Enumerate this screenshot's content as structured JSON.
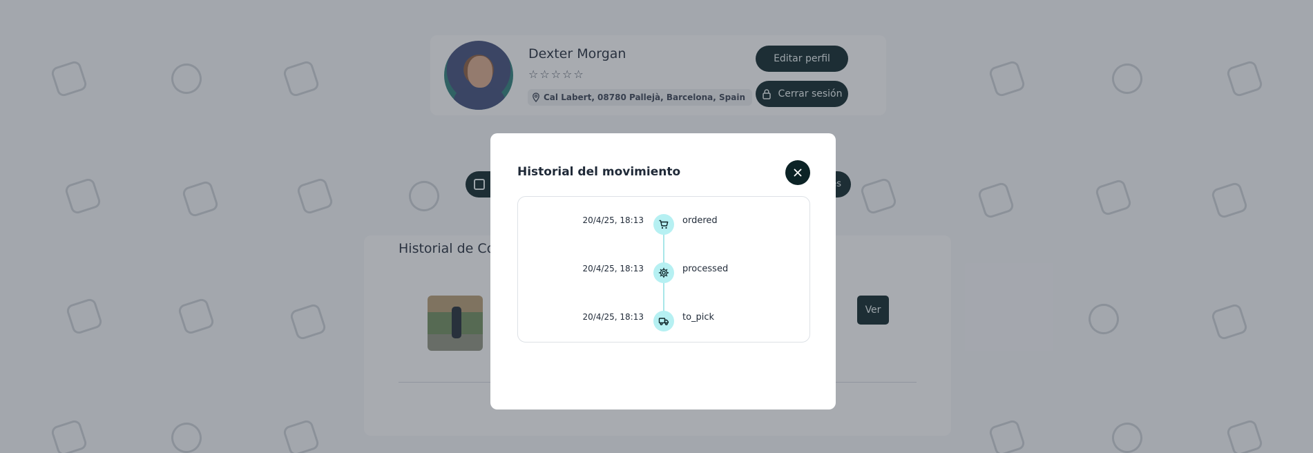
{
  "profile": {
    "name": "Dexter Morgan",
    "rating_stars": [
      "☆",
      "☆",
      "☆",
      "☆",
      "☆"
    ],
    "location": "Cal Labert, 08780 Pallejà, Barcelona, Spain",
    "edit_label": "Editar perfil",
    "logout_label": "Cerrar sesión"
  },
  "nav": {
    "tail_text": "es"
  },
  "purchases": {
    "title_visible": "Historial de Co",
    "view_label": "Ver"
  },
  "modal": {
    "title": "Historial del movimiento",
    "timeline": [
      {
        "date": "20/4/25, 18:13",
        "status": "ordered",
        "icon": "cart-icon"
      },
      {
        "date": "20/4/25, 18:13",
        "status": "processed",
        "icon": "gear-icon"
      },
      {
        "date": "20/4/25, 18:13",
        "status": "to_pick",
        "icon": "truck-icon"
      }
    ]
  },
  "colors": {
    "primary_dark": "#0c2326",
    "timeline_accent": "#b6f0f2",
    "overlay": "rgba(55,63,75,0.42)"
  }
}
